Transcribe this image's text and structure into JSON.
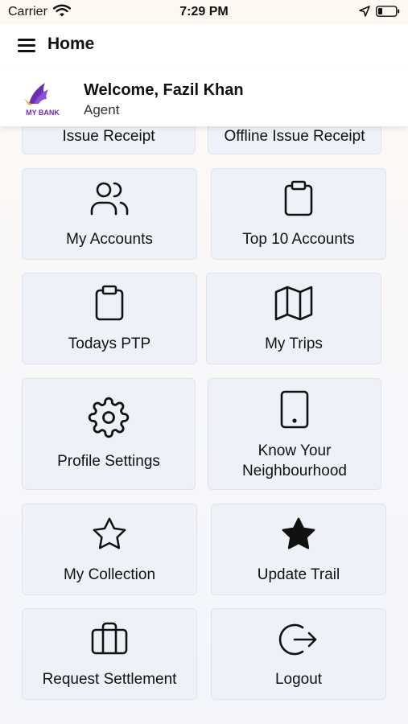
{
  "status_bar": {
    "carrier": "Carrier",
    "time": "7:29 PM"
  },
  "header": {
    "title": "Home"
  },
  "profile": {
    "welcome": "Welcome, Fazil Khan",
    "role": "Agent",
    "logo_text": "MY BANK"
  },
  "menu": {
    "issue_receipt": "Issue Receipt",
    "offline_issue_receipt": "Offline Issue Receipt",
    "my_accounts": "My Accounts",
    "top_10_accounts": "Top 10 Accounts",
    "todays_ptp": "Todays PTP",
    "my_trips": "My Trips",
    "profile_settings": "Profile Settings",
    "know_your_neighbourhood": "Know Your Neighbourhood",
    "my_collection": "My Collection",
    "update_trail": "Update Trail",
    "request_settlement": "Request Settlement",
    "logout": "Logout"
  },
  "icons": {
    "my_accounts": "users-icon",
    "top_10_accounts": "clipboard-icon",
    "todays_ptp": "clipboard-icon",
    "my_trips": "map-icon",
    "profile_settings": "gear-icon",
    "know_your_neighbourhood": "tablet-icon",
    "my_collection": "star-outline-icon",
    "update_trail": "star-filled-icon",
    "request_settlement": "briefcase-icon",
    "logout": "logout-icon"
  },
  "colors": {
    "tile_bg": "#eef2f8",
    "brand_purple": "#6a2db3"
  }
}
